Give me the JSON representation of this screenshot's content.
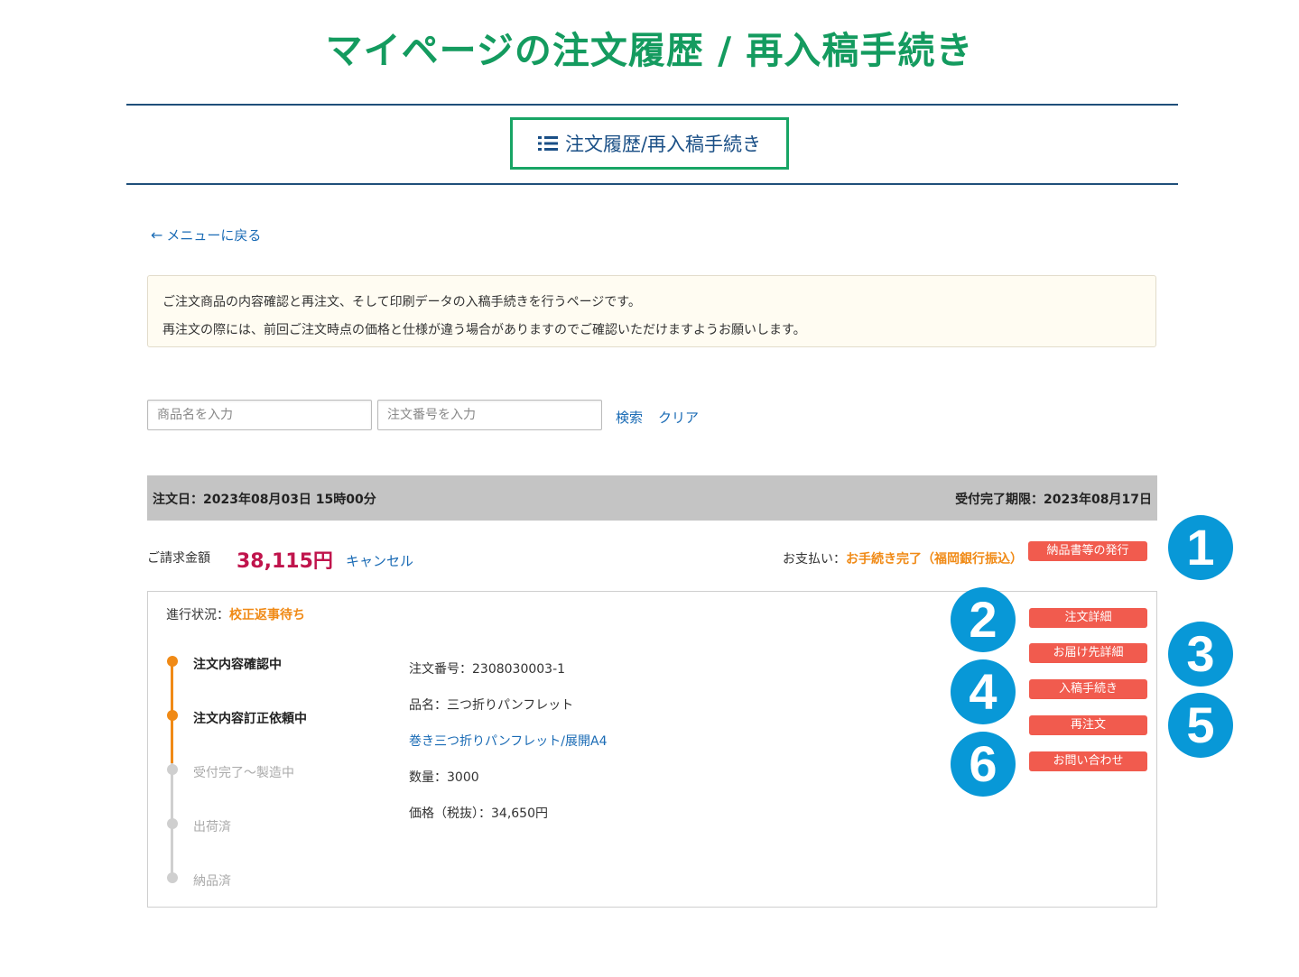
{
  "page_heading": "マイページの注文履歴 / 再入稿手続き",
  "section_title": "注文履歴/再入稿手続き",
  "back_link": "メニューに戻る",
  "notice": {
    "line1": "ご注文商品の内容確認と再注文、そして印刷データの入稿手続きを行うページです。",
    "line2": "再注文の際には、前回ご注文時点の価格と仕様が違う場合がありますのでご確認いただけますようお願いします。"
  },
  "search": {
    "product_placeholder": "商品名を入力",
    "order_placeholder": "注文番号を入力",
    "search_label": "検索",
    "clear_label": "クリア"
  },
  "order": {
    "date": "注文日：2023年08月03日 15時00分",
    "deadline": "受付完了期限：2023年08月17日",
    "bill_label": "ご請求金額",
    "bill_amount": "38,115円",
    "cancel_label": "キャンセル",
    "payment_label": "お支払い：",
    "payment_status": "お手続き完了（福岡銀行振込）",
    "invoice_button": "納品書等の発行",
    "progress_label": "進行状況：",
    "progress_value": "校正返事待ち",
    "steps": [
      {
        "label": "注文内容確認中"
      },
      {
        "label": "注文内容訂正依頼中"
      },
      {
        "label": "受付完了～製造中"
      },
      {
        "label": "出荷済"
      },
      {
        "label": "納品済"
      }
    ],
    "details": {
      "order_number": "注文番号：2308030003-1",
      "product_name": "品名：三つ折りパンフレット",
      "product_link": "巻き三つ折りパンフレット/展開A4",
      "quantity": "数量：3000",
      "price": "価格（税抜）：34,650円"
    },
    "actions": {
      "order_detail": "注文詳細",
      "delivery_detail": "お届け先詳細",
      "submit_data": "入稿手続き",
      "reorder": "再注文",
      "inquiry": "お問い合わせ"
    }
  },
  "badges": [
    "1",
    "2",
    "3",
    "4",
    "5",
    "6"
  ],
  "colors": {
    "heading_green": "#149b5f",
    "button_red": "#f15b4e",
    "badge_blue": "#0898d7",
    "orange": "#f08a16",
    "amount_red": "#c0144c"
  }
}
